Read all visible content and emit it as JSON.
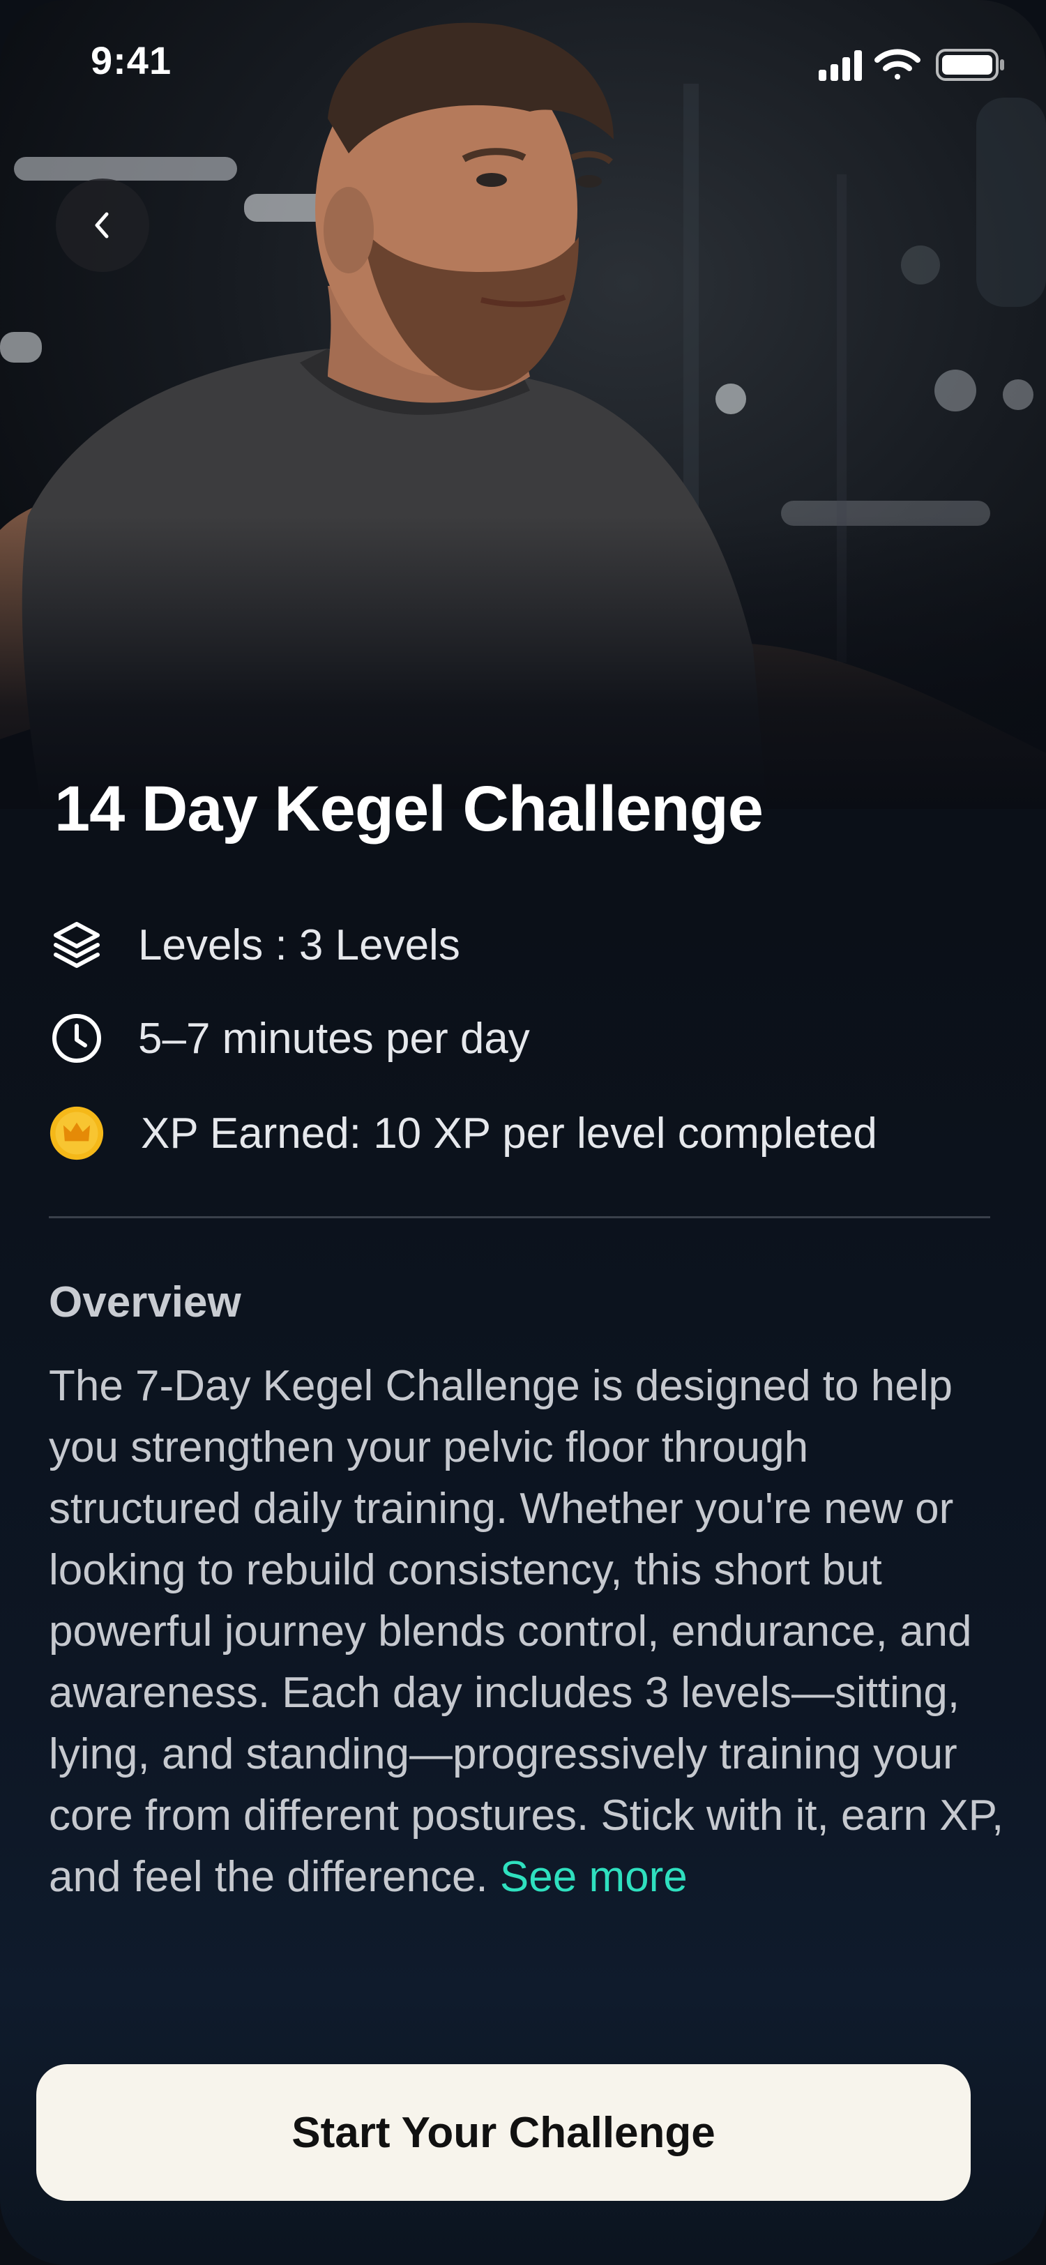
{
  "status_bar": {
    "time": "9:41",
    "icons": [
      "signal-icon",
      "wifi-icon",
      "battery-icon"
    ]
  },
  "header": {
    "back_icon": "chevron-left-icon"
  },
  "challenge": {
    "title": "14 Day Kegel Challenge",
    "details": [
      {
        "icon": "layers-icon",
        "text": "Levels : 3 Levels"
      },
      {
        "icon": "clock-icon",
        "text": "5–7 minutes per day"
      },
      {
        "icon": "crown-coin-icon",
        "text": "XP Earned: 10 XP per level completed"
      }
    ],
    "overview": {
      "heading": "Overview",
      "body": "The 7-Day Kegel Challenge is designed to help you strengthen your pelvic floor through structured daily training. Whether you're new or looking to rebuild consistency, this short but powerful journey blends control, endurance, and awareness. Each day includes 3 levels—sitting, lying, and standing—progressively training your core from different postures. Stick with it, earn XP, and feel the difference.",
      "see_more": "See more"
    }
  },
  "cta": {
    "label": "Start Your Challenge"
  },
  "colors": {
    "background": "#0b1018",
    "accent": "#2fe0bf",
    "cta_bg": "#f7f4ec",
    "coin": "#f5b819"
  }
}
